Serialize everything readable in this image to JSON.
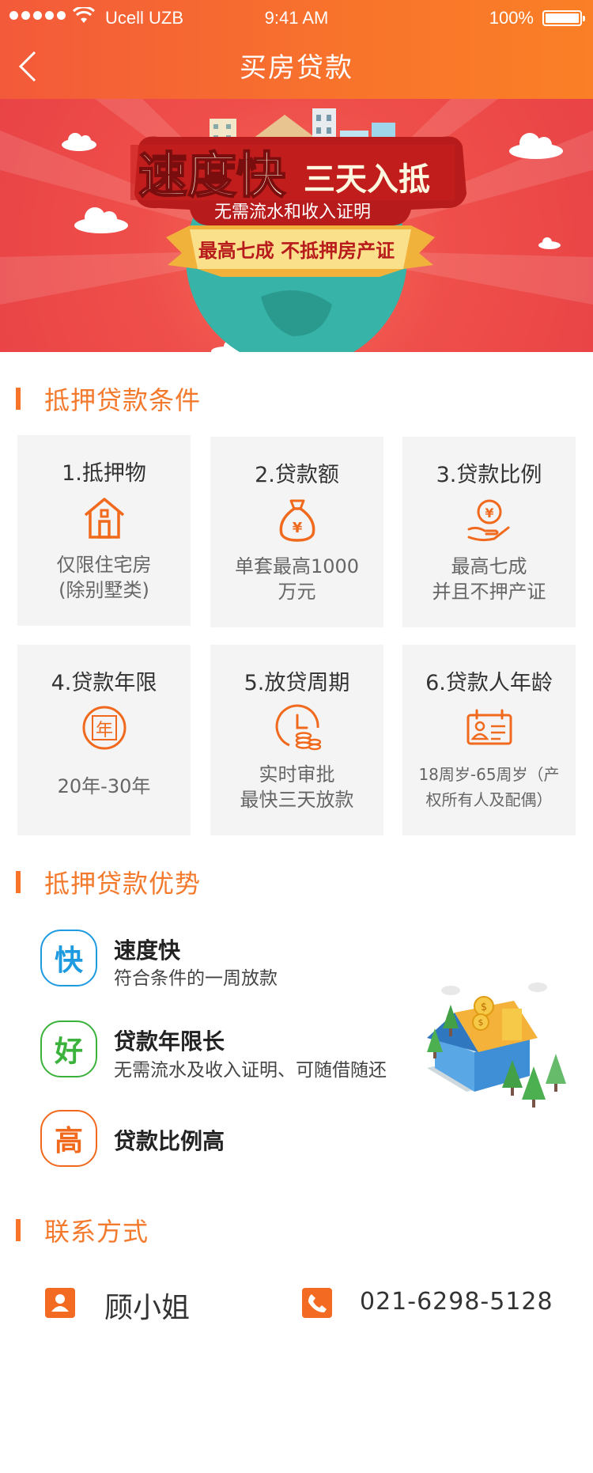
{
  "status_bar": {
    "carrier": "Ucell UZB",
    "time": "9:41 AM",
    "battery": "100%"
  },
  "nav": {
    "title": "买房贷款"
  },
  "banner": {
    "headline_big": "速度快",
    "headline_small": "三天入抵",
    "subline": "无需流水和收入证明",
    "ribbon": "最高七成 不抵押房产证"
  },
  "conditions": {
    "heading": "抵押贷款条件",
    "cards": [
      {
        "title": "1.抵押物",
        "icon": "house-icon",
        "desc1": "仅限住宅房",
        "desc2": "(除别墅类)"
      },
      {
        "title": "2.贷款额",
        "icon": "money-bag-icon",
        "desc1": "单套最高1000",
        "desc2": "万元"
      },
      {
        "title": "3.贷款比例",
        "icon": "hand-coin-icon",
        "desc1": "最高七成",
        "desc2": "并且不押产证"
      },
      {
        "title": "4.贷款年限",
        "icon": "year-icon",
        "icon_char": "年",
        "desc1": "20年-30年",
        "desc2": ""
      },
      {
        "title": "5.放贷周期",
        "icon": "clock-coins-icon",
        "desc1": "实时审批",
        "desc2": "最快三天放款"
      },
      {
        "title": "6.贷款人年龄",
        "icon": "id-card-icon",
        "desc1": "18周岁-65周岁（产",
        "desc2": "权所有人及配偶）"
      }
    ]
  },
  "advantages": {
    "heading": "抵押贷款优势",
    "items": [
      {
        "badge": "快",
        "title": "速度快",
        "desc": "符合条件的一周放款",
        "color": "#1e9be0"
      },
      {
        "badge": "好",
        "title": "贷款年限长",
        "desc": "无需流水及收入证明、可随借随还",
        "color": "#3bb23b"
      },
      {
        "badge": "高",
        "title": "贷款比例高",
        "desc": "",
        "color": "#f0691c"
      }
    ]
  },
  "contact": {
    "heading": "联系方式",
    "name": "顾小姐",
    "phone": "021-6298-5128"
  },
  "colors": {
    "accent": "#f8742b",
    "banner_red": "#ef4f4a",
    "card_bg": "#f4f4f4"
  }
}
